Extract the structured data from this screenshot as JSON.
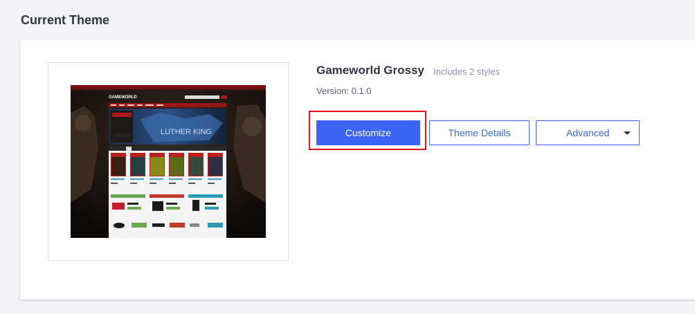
{
  "section": {
    "title": "Current Theme"
  },
  "theme": {
    "name": "Gameworld Grossy",
    "styles_note": "Includes 2 styles",
    "version_label": "Version: 0.1.0",
    "preview_logo": "GAMEWORLD",
    "preview_banner": "LUTHER KING"
  },
  "actions": {
    "customize_label": "Customize",
    "details_label": "Theme Details",
    "advanced_label": "Advanced"
  },
  "colors": {
    "primary": "#3c64f4",
    "highlight": "#e3101b",
    "background": "#f3f4f7"
  },
  "icons": {
    "dropdown": "chevron-down-icon"
  }
}
